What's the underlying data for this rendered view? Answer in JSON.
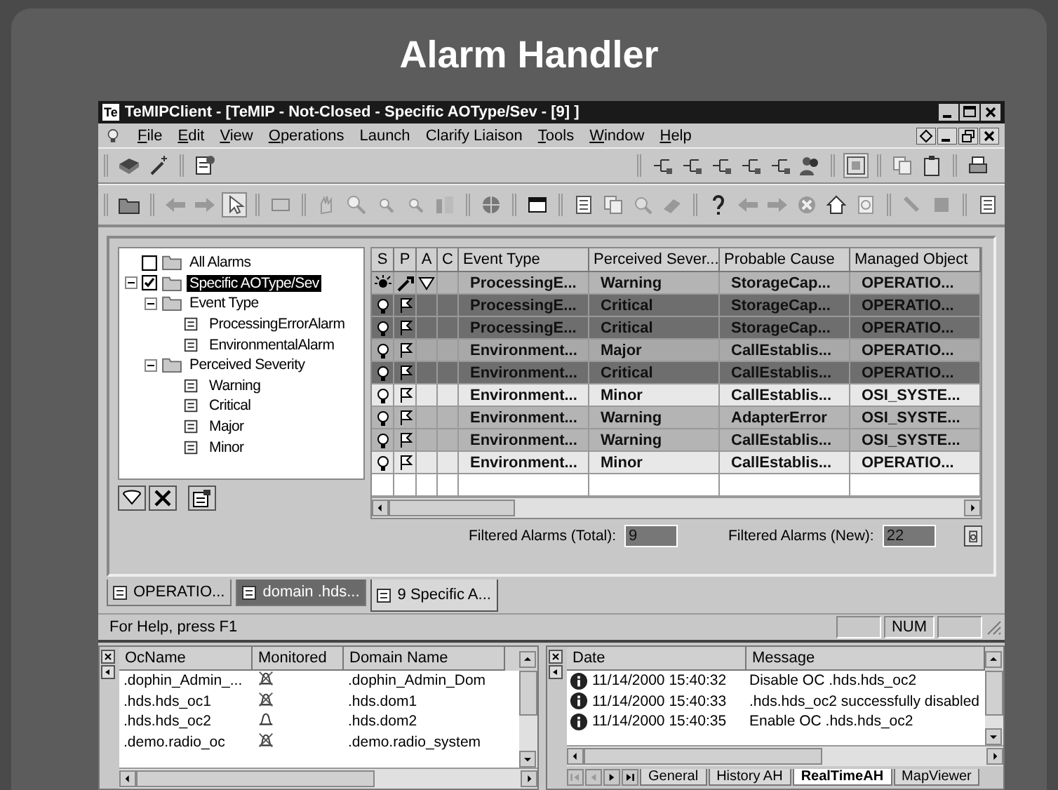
{
  "page_title": "Alarm Handler",
  "window": {
    "logo": "Te",
    "title": "TeMIPClient - [TeMIP - Not-Closed - Specific AOType/Sev - [9] ]"
  },
  "menu": [
    {
      "label": "File",
      "accelerator": true
    },
    {
      "label": "Edit",
      "accelerator": true
    },
    {
      "label": "View",
      "accelerator": true
    },
    {
      "label": "Operations",
      "accelerator": true
    },
    {
      "label": "Launch",
      "accelerator": false
    },
    {
      "label": "Clarify Liaison",
      "accelerator": false
    },
    {
      "label": "Tools",
      "accelerator": true
    },
    {
      "label": "Window",
      "accelerator": true
    },
    {
      "label": "Help",
      "accelerator": true
    }
  ],
  "tree": [
    {
      "label": "All Alarms",
      "kind": "folder",
      "checked": false,
      "selected": false
    },
    {
      "label": "Specific AOType/Sev",
      "kind": "folder",
      "checked": true,
      "selected": true,
      "expanded": true,
      "children": [
        {
          "label": "Event Type",
          "kind": "folder",
          "selected": false,
          "expanded": true,
          "children": [
            {
              "label": "ProcessingErrorAlarm",
              "kind": "leaf",
              "selected": false
            },
            {
              "label": "EnvironmentalAlarm",
              "kind": "leaf",
              "selected": false
            }
          ]
        },
        {
          "label": "Perceived Severity",
          "kind": "folder",
          "selected": false,
          "expanded": true,
          "children": [
            {
              "label": "Warning",
              "kind": "leaf",
              "selected": false
            },
            {
              "label": "Critical",
              "kind": "leaf",
              "selected": false
            },
            {
              "label": "Major",
              "kind": "leaf",
              "selected": false
            },
            {
              "label": "Minor",
              "kind": "leaf",
              "selected": false
            }
          ]
        }
      ]
    }
  ],
  "grid": {
    "columns": [
      "S",
      "P",
      "A",
      "C",
      "Event Type",
      "Perceived Sever...",
      "Probable Cause",
      "Managed Object"
    ],
    "rows": [
      {
        "new": true,
        "color": "#b4b4b4",
        "cells": [
          "ProcessingE...",
          "Warning",
          "StorageCap...",
          "OPERATIO..."
        ]
      },
      {
        "new": false,
        "color": "#6e6e6e",
        "cells": [
          "ProcessingE...",
          "Critical",
          "StorageCap...",
          "OPERATIO..."
        ]
      },
      {
        "new": false,
        "color": "#6e6e6e",
        "cells": [
          "ProcessingE...",
          "Critical",
          "StorageCap...",
          "OPERATIO..."
        ]
      },
      {
        "new": false,
        "color": "#a8a8a8",
        "cells": [
          "Environment...",
          "Major",
          "CallEstablis...",
          "OPERATIO..."
        ]
      },
      {
        "new": false,
        "color": "#6e6e6e",
        "cells": [
          "Environment...",
          "Critical",
          "CallEstablis...",
          "OPERATIO..."
        ]
      },
      {
        "new": false,
        "color": "#e8e8e8",
        "cells": [
          "Environment...",
          "Minor",
          "CallEstablis...",
          "OSI_SYSTE..."
        ]
      },
      {
        "new": false,
        "color": "#b4b4b4",
        "cells": [
          "Environment...",
          "Warning",
          "AdapterError",
          "OSI_SYSTE..."
        ]
      },
      {
        "new": false,
        "color": "#b4b4b4",
        "cells": [
          "Environment...",
          "Warning",
          "CallEstablis...",
          "OSI_SYSTE..."
        ]
      },
      {
        "new": false,
        "color": "#e8e8e8",
        "cells": [
          "Environment...",
          "Minor",
          "CallEstablis...",
          "OPERATIO..."
        ]
      }
    ]
  },
  "filter": {
    "total_label": "Filtered Alarms (Total):",
    "total": "9",
    "new_label": "Filtered Alarms (New):",
    "new": "22"
  },
  "doc_tabs": [
    {
      "label": "OPERATIO...",
      "selected": false,
      "disabled": false
    },
    {
      "label": "domain .hds...",
      "selected": false,
      "disabled": true
    },
    {
      "label": "9  Specific A...",
      "selected": true,
      "disabled": false
    }
  ],
  "status_bar": {
    "text": "For Help, press F1",
    "num": "NUM"
  },
  "oc_table": {
    "columns": [
      "OcName",
      "Monitored",
      "Domain Name"
    ],
    "rows": [
      {
        "name": ".dophin_Admin_...",
        "monitored": false,
        "domain": ".dophin_Admin_Dom"
      },
      {
        "name": ".hds.hds_oc1",
        "monitored": false,
        "domain": ".hds.dom1"
      },
      {
        "name": ".hds.hds_oc2",
        "monitored": true,
        "domain": ".hds.dom2"
      },
      {
        "name": ".demo.radio_oc",
        "monitored": false,
        "domain": ".demo.radio_system"
      }
    ]
  },
  "log": {
    "columns": [
      "Date",
      "Message"
    ],
    "rows": [
      {
        "date": "11/14/2000 15:40:32",
        "message": "Disable OC .hds.hds_oc2"
      },
      {
        "date": "11/14/2000 15:40:33",
        "message": ".hds.hds_oc2  successfully disabled"
      },
      {
        "date": "11/14/2000 15:40:35",
        "message": "Enable OC .hds.hds_oc2"
      }
    ],
    "tabs": [
      {
        "label": "General",
        "selected": false
      },
      {
        "label": "History AH",
        "selected": false
      },
      {
        "label": "RealTimeAH",
        "selected": true
      },
      {
        "label": "MapViewer",
        "selected": false
      }
    ]
  }
}
